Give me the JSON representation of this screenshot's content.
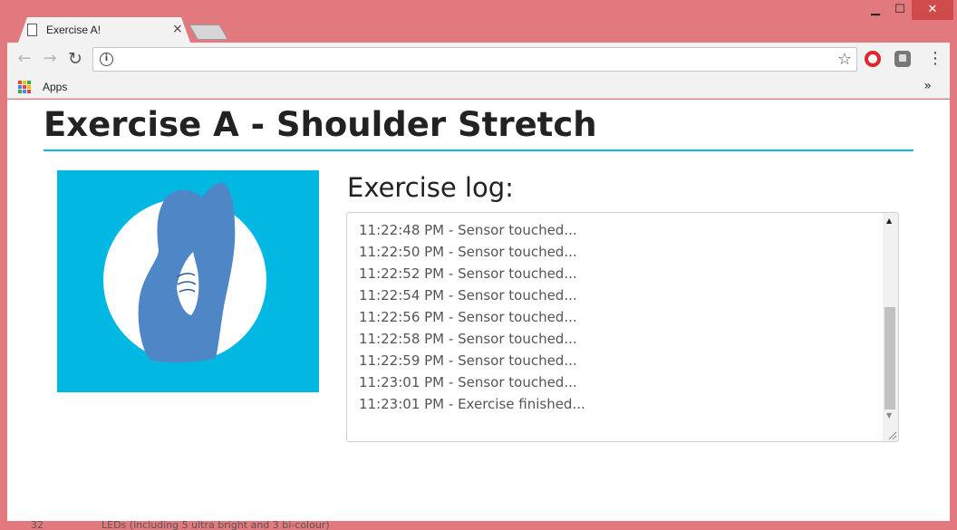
{
  "browser": {
    "tab_title": "Exercise A!",
    "tab_close": "×",
    "window_controls": {
      "minimize": "▁",
      "maximize": "☐",
      "close": "✕"
    },
    "nav": {
      "back": "←",
      "forward": "→",
      "reload": "↻"
    },
    "address": {
      "value": "",
      "info_icon": "i",
      "star": "☆"
    },
    "menu": "⋮",
    "bookmarks": {
      "apps_label": "Apps",
      "overflow": "»"
    },
    "apps_icon_colors": [
      "#ea4335",
      "#fbbc05",
      "#34a853",
      "#4285f4",
      "#ea4335",
      "#fbbc05",
      "#34a853",
      "#4285f4",
      "#ea4335"
    ]
  },
  "page": {
    "title": "Exercise A - Shoulder Stretch",
    "accent_color": "#0ab8e6",
    "illustration_bg": "#00b8e2",
    "illustration_figure_color": "#4f86c6",
    "log_heading": "Exercise log:",
    "log_entries": [
      "11:22:48 PM - Sensor touched...",
      "11:22:50 PM - Sensor touched...",
      "11:22:52 PM - Sensor touched...",
      "11:22:54 PM - Sensor touched...",
      "11:22:56 PM - Sensor touched...",
      "11:22:58 PM - Sensor touched...",
      "11:22:59 PM - Sensor touched...",
      "11:23:01 PM - Sensor touched...",
      "11:23:01 PM - Exercise finished..."
    ]
  },
  "background_window": {
    "number": "32",
    "text": "LEDs (including 5 ultra bright and 3 bi-colour)"
  }
}
